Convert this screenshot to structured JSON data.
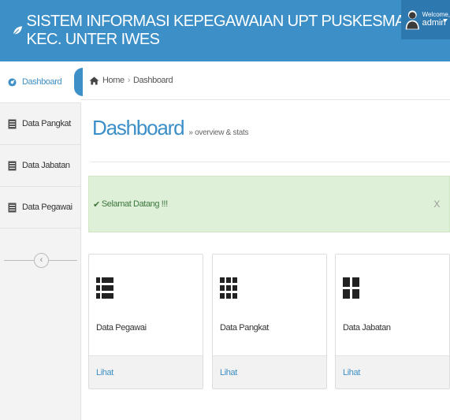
{
  "header": {
    "title": "SISTEM INFORMASI KEPEGAWAIAN UPT PUSKESMAS KEC. UNTER IWES",
    "brand_icon": "leaf-icon",
    "user": {
      "welcome": "Welcome,",
      "name": "admin"
    }
  },
  "colors": {
    "primary": "#3d8fc7",
    "header_dark": "#2e78b0",
    "alert_bg": "#dff0d8",
    "alert_text": "#3c763d"
  },
  "sidebar": {
    "items": [
      {
        "label": "Dashboard",
        "icon": "dashboard-icon",
        "active": true
      },
      {
        "label": "Data Pangkat",
        "icon": "document-icon",
        "active": false
      },
      {
        "label": "Data Jabatan",
        "icon": "document-icon",
        "active": false
      },
      {
        "label": "Data Pegawai",
        "icon": "document-icon",
        "active": false
      }
    ],
    "collapse_glyph": "‹"
  },
  "breadcrumb": {
    "home": "Home",
    "separator": "›",
    "current": "Dashboard"
  },
  "page": {
    "title": "Dashboard",
    "subtitle": "» overview & stats"
  },
  "alert": {
    "check": "✔",
    "message": "Selamat Datang !!!",
    "close": "X"
  },
  "cards": [
    {
      "label": "Data Pegawai",
      "link": "Lihat",
      "icon": "list-icon"
    },
    {
      "label": "Data Pangkat",
      "link": "Lihat",
      "icon": "grid-icon"
    },
    {
      "label": "Data Jabatan",
      "link": "Lihat",
      "icon": "columns-icon"
    }
  ]
}
